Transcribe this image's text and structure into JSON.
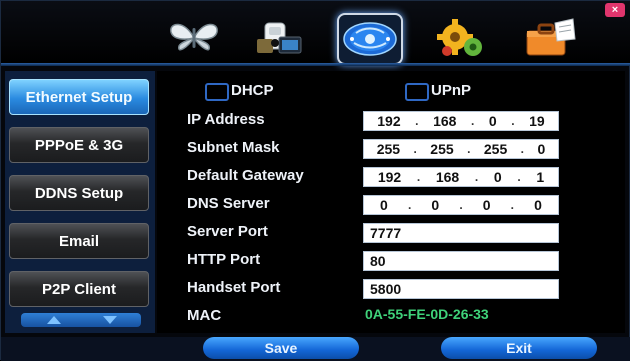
{
  "window": {
    "close_label": "×"
  },
  "top_tabs": [
    {
      "icon": "butterfly-icon",
      "active": false
    },
    {
      "icon": "camera-icon",
      "active": false
    },
    {
      "icon": "network-globe-icon",
      "active": true
    },
    {
      "icon": "gears-icon",
      "active": false
    },
    {
      "icon": "toolbox-icon",
      "active": false
    }
  ],
  "sidebar": {
    "items": [
      {
        "label": "Ethernet Setup",
        "active": true
      },
      {
        "label": "PPPoE & 3G",
        "active": false
      },
      {
        "label": "DDNS Setup",
        "active": false
      },
      {
        "label": "Email",
        "active": false
      },
      {
        "label": "P2P Client",
        "active": false
      }
    ]
  },
  "options": {
    "dhcp_label": "DHCP",
    "upnp_label": "UPnP",
    "dhcp_checked": false,
    "upnp_checked": false
  },
  "fields": {
    "ip_address": {
      "label": "IP Address",
      "octets": [
        "192",
        "168",
        "0",
        "19"
      ]
    },
    "subnet_mask": {
      "label": "Subnet Mask",
      "octets": [
        "255",
        "255",
        "255",
        "0"
      ]
    },
    "default_gateway": {
      "label": "Default Gateway",
      "octets": [
        "192",
        "168",
        "0",
        "1"
      ]
    },
    "dns_server": {
      "label": "DNS Server",
      "octets": [
        "0",
        "0",
        "0",
        "0"
      ]
    },
    "server_port": {
      "label": "Server Port",
      "value": "7777"
    },
    "http_port": {
      "label": "HTTP Port",
      "value": "80"
    },
    "handset_port": {
      "label": "Handset Port",
      "value": "5800"
    },
    "mac": {
      "label": "MAC",
      "value": "0A-55-FE-0D-26-33"
    }
  },
  "buttons": {
    "save_label": "Save",
    "exit_label": "Exit"
  },
  "colors": {
    "accent": "#1b67b8",
    "mac_text": "#3fd27a",
    "checkbox_border": "#2f68c4"
  }
}
